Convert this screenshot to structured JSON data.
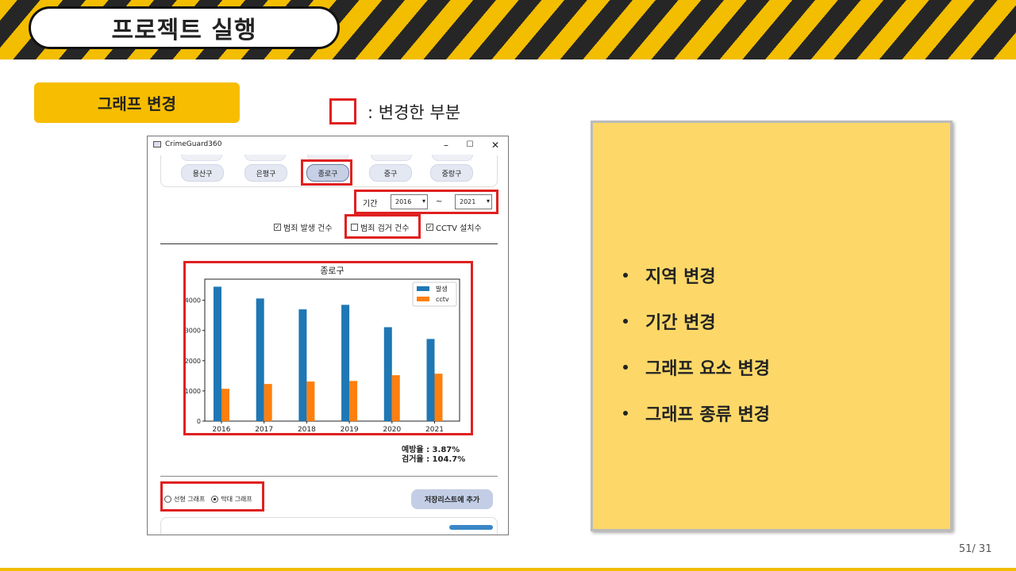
{
  "slide": {
    "title": "프로젝트 실행",
    "section": "그래프 변경",
    "legend_label": ": 변경한 부분",
    "page_number": "51/ 31",
    "colors": {
      "stripe_yellow": "#f3bd00",
      "stripe_dark": "#262626",
      "highlight": "#e02020",
      "note_bg": "#fdd868"
    }
  },
  "window": {
    "title": "CrimeGuard360",
    "controls": {
      "minimize": "–",
      "maximize": "☐",
      "close": "✕"
    },
    "districts": [
      "용산구",
      "은평구",
      "종로구",
      "중구",
      "중랑구"
    ],
    "selected_district": "종로구",
    "period": {
      "label": "기간",
      "from": "2016",
      "to": "2021",
      "separator": "~"
    },
    "checkboxes": [
      {
        "label": "범죄 발생 건수",
        "checked": true
      },
      {
        "label": "범죄 검거 건수",
        "checked": false
      },
      {
        "label": "CCTV 설치수",
        "checked": true
      }
    ],
    "stats": {
      "prevention": "예방율 : 3.87%",
      "arrest": "검거율 : 104.7%"
    },
    "graph_types": [
      {
        "label": "선형 그래프",
        "selected": false
      },
      {
        "label": "막대 그래프",
        "selected": true
      }
    ],
    "save_button": "저장리스트에 추가"
  },
  "chart_data": {
    "type": "bar",
    "title": "종로구",
    "categories": [
      "2016",
      "2017",
      "2018",
      "2019",
      "2020",
      "2021"
    ],
    "series": [
      {
        "name": "발생",
        "color": "#1f77b4",
        "values": [
          4450,
          4060,
          3700,
          3850,
          3110,
          2720
        ]
      },
      {
        "name": "cctv",
        "color": "#ff7f0e",
        "values": [
          1070,
          1230,
          1310,
          1330,
          1520,
          1570
        ]
      }
    ],
    "yticks": [
      "0",
      "1000",
      "2000",
      "3000",
      "4000"
    ],
    "ylim": [
      0,
      4700
    ],
    "legend": "top-right"
  },
  "note": {
    "items": [
      "지역 변경",
      "기간 변경",
      "그래프 요소 변경",
      "그래프 종류 변경"
    ]
  }
}
